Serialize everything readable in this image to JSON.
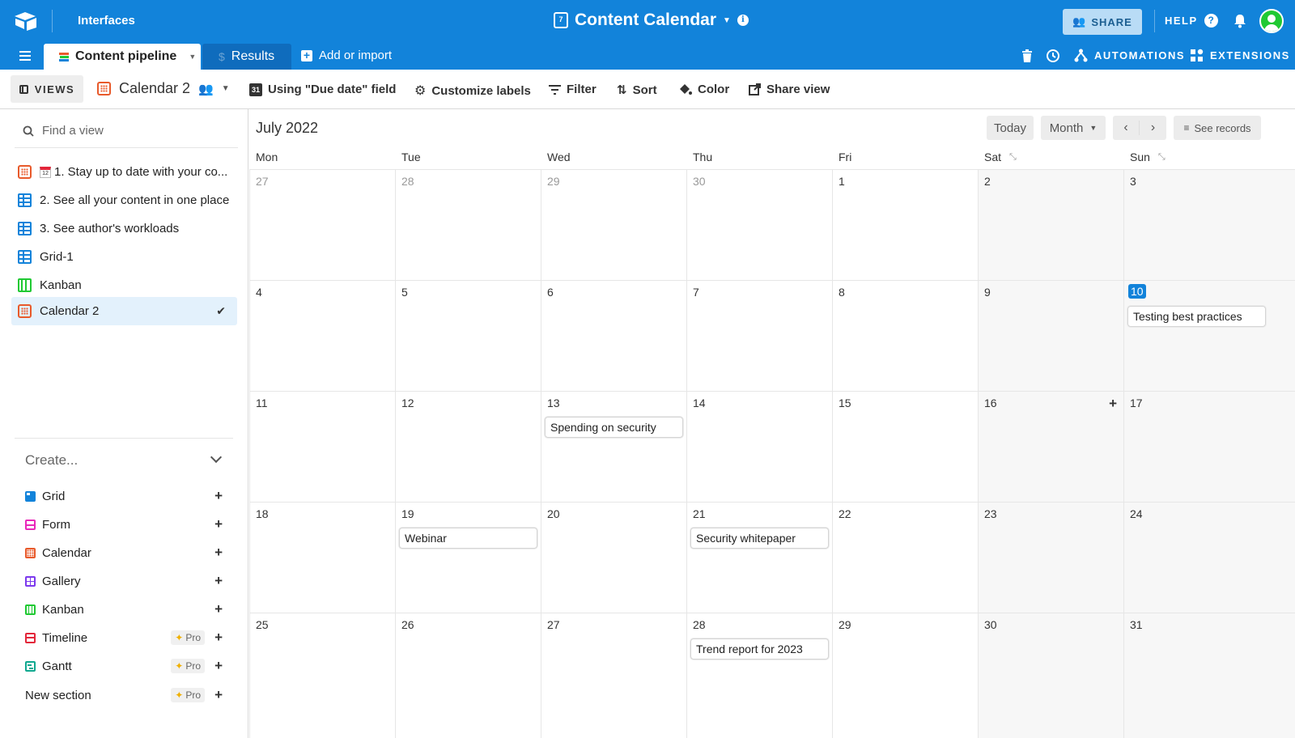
{
  "topbar": {
    "interfaces_label": "Interfaces",
    "base_title": "Content Calendar",
    "cal_icon_day": "7",
    "share_label": "SHARE",
    "help_label": "HELP"
  },
  "tabs": {
    "active_label": "Content pipeline",
    "results_label": "Results",
    "add_import_label": "Add or import",
    "automations_label": "AUTOMATIONS",
    "extensions_label": "EXTENSIONS"
  },
  "viewbar": {
    "views_label": "VIEWS",
    "current_view": "Calendar 2",
    "date_field_label": "Using \"Due date\" field",
    "date_field_icon_day": "31",
    "customize_labels": "Customize labels",
    "filter_label": "Filter",
    "sort_label": "Sort",
    "color_label": "Color",
    "share_view_label": "Share view"
  },
  "sidebar": {
    "find_placeholder": "Find a view",
    "views": [
      {
        "label": "1. Stay up to date with your co...",
        "icon": "calendar-icon",
        "emoji_date": "12"
      },
      {
        "label": "2. See all your content in one place",
        "icon": "grid-icon"
      },
      {
        "label": "3. See author's workloads",
        "icon": "grid-icon"
      },
      {
        "label": "Grid-1",
        "icon": "grid-icon"
      },
      {
        "label": "Kanban",
        "icon": "kanban-icon"
      },
      {
        "label": "Calendar 2",
        "icon": "calendar-icon",
        "selected": true
      }
    ],
    "create_label": "Create...",
    "create_items": [
      {
        "label": "Grid",
        "color": "#1283da"
      },
      {
        "label": "Form",
        "color": "#e929ba"
      },
      {
        "label": "Calendar",
        "color": "#e85a2b"
      },
      {
        "label": "Gallery",
        "color": "#7c39ed"
      },
      {
        "label": "Kanban",
        "color": "#20c933"
      },
      {
        "label": "Timeline",
        "color": "#e3263a",
        "pro": true
      },
      {
        "label": "Gantt",
        "color": "#0fa88f",
        "pro": true
      },
      {
        "label": "New section",
        "pro": true
      }
    ],
    "pro_label": "Pro"
  },
  "calendar": {
    "month_title": "July 2022",
    "today_label": "Today",
    "range_label": "Month",
    "see_records_label": "See records",
    "weekdays": [
      "Mon",
      "Tue",
      "Wed",
      "Thu",
      "Fri",
      "Sat",
      "Sun"
    ],
    "weeks": [
      [
        "27",
        "28",
        "29",
        "30",
        "1",
        "2",
        "3"
      ],
      [
        "4",
        "5",
        "6",
        "7",
        "8",
        "9",
        "10"
      ],
      [
        "11",
        "12",
        "13",
        "14",
        "15",
        "16",
        "17"
      ],
      [
        "18",
        "19",
        "20",
        "21",
        "22",
        "23",
        "24"
      ],
      [
        "25",
        "26",
        "27",
        "28",
        "29",
        "30",
        "31"
      ]
    ],
    "events": {
      "jul10": "Testing best practices",
      "jul13": "Spending on security",
      "jul19": "Webinar",
      "jul21": "Security whitepaper",
      "jul28": "Trend report for 2023"
    }
  },
  "colors": {
    "brand_blue": "#1283da",
    "accent_orange": "#e85a2b",
    "avatar_green": "#20c933"
  }
}
